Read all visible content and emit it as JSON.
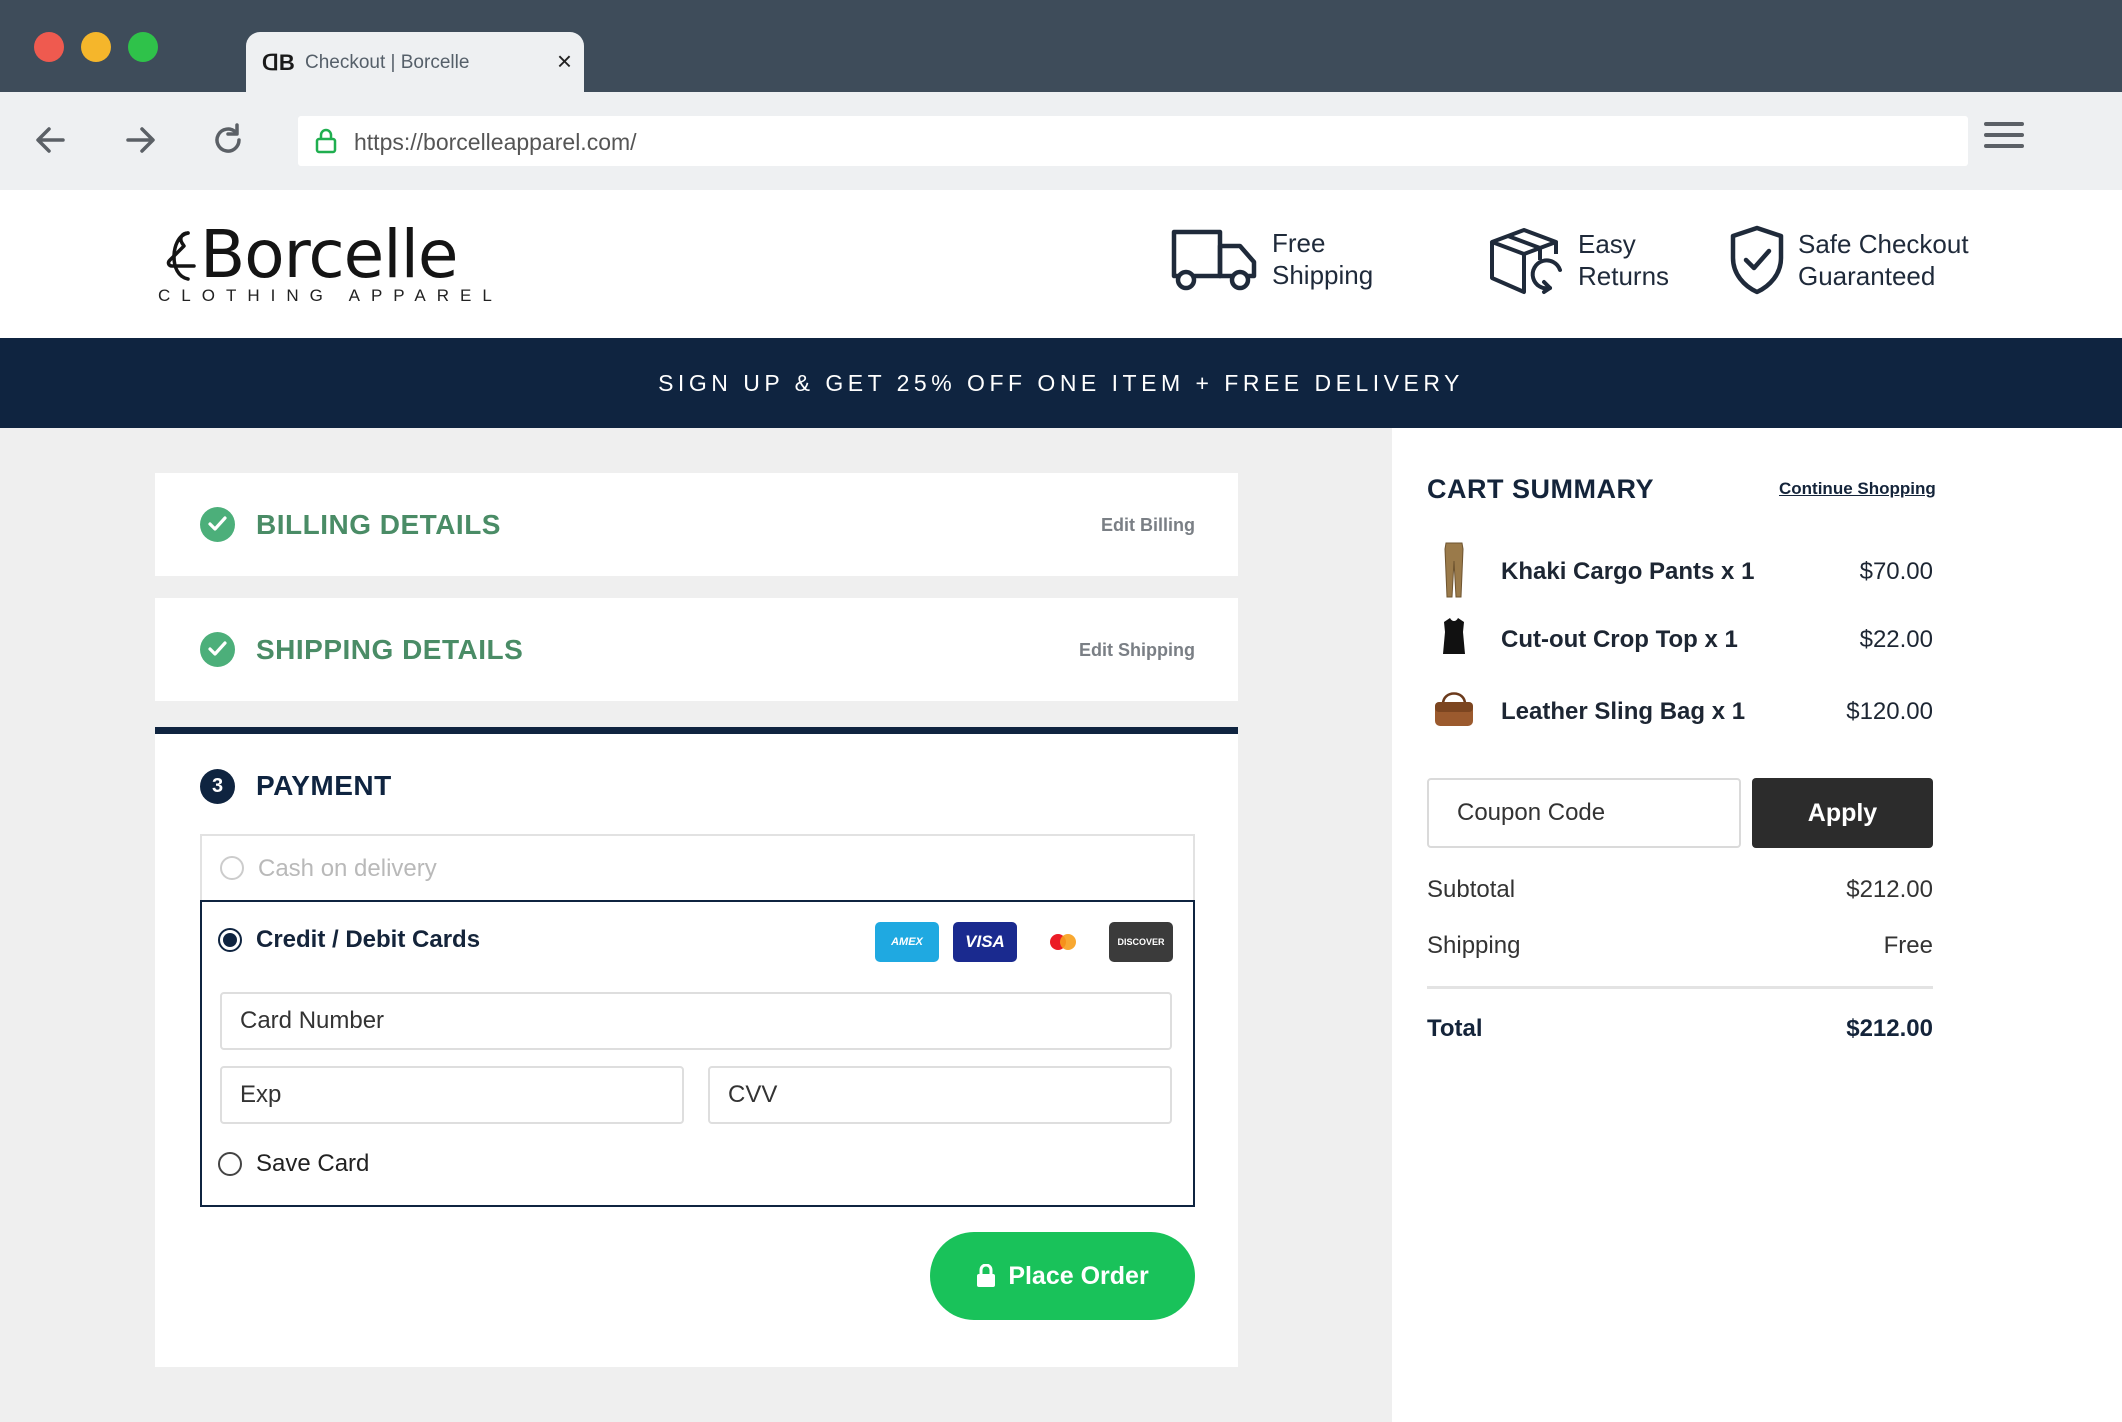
{
  "browser": {
    "tab_favicon": "ᗡB",
    "tab_title": "Checkout | Borcelle",
    "tab_close": "×",
    "url": "https://borcelleapparel.com/"
  },
  "header": {
    "logo_word": "Borcelle",
    "logo_sub": "CLOTHING APPAREL",
    "features": [
      {
        "icon": "truck-icon",
        "line1": "Free",
        "line2": "Shipping"
      },
      {
        "icon": "box-return-icon",
        "line1": "Easy",
        "line2": "Returns"
      },
      {
        "icon": "shield-check-icon",
        "line1": "Safe Checkout",
        "line2": "Guaranteed"
      }
    ]
  },
  "promo": {
    "text": "SIGN UP & GET 25% OFF ONE ITEM + FREE DELIVERY"
  },
  "checkout": {
    "billing": {
      "title": "BILLING DETAILS",
      "edit": "Edit Billing"
    },
    "shipping": {
      "title": "SHIPPING DETAILS",
      "edit": "Edit Shipping"
    },
    "payment": {
      "step": "3",
      "title": "PAYMENT",
      "cod_label": "Cash on delivery",
      "card_label": "Credit / Debit Cards",
      "card_brands": [
        "AMEX",
        "VISA",
        "Mastercard",
        "DISCOVER"
      ],
      "card_number_placeholder": "Card Number",
      "exp_placeholder": "Exp",
      "cvv_placeholder": "CVV",
      "save_card_label": "Save Card",
      "place_order": "Place Order"
    }
  },
  "cart": {
    "title": "CART SUMMARY",
    "continue": "Continue Shopping",
    "items": [
      {
        "name": "Khaki Cargo Pants x 1",
        "price": "$70.00"
      },
      {
        "name": "Cut-out Crop Top x 1",
        "price": "$22.00"
      },
      {
        "name": "Leather Sling Bag x 1",
        "price": "$120.00"
      }
    ],
    "coupon_placeholder": "Coupon Code",
    "apply": "Apply",
    "subtotal_label": "Subtotal",
    "subtotal": "$212.00",
    "shipping_label": "Shipping",
    "shipping": "Free",
    "total_label": "Total",
    "total": "$212.00"
  },
  "colors": {
    "navy": "#0f2440",
    "success_green": "#4caf7a",
    "place_order_green": "#19c25a",
    "chrome": "#3e4c5a"
  }
}
